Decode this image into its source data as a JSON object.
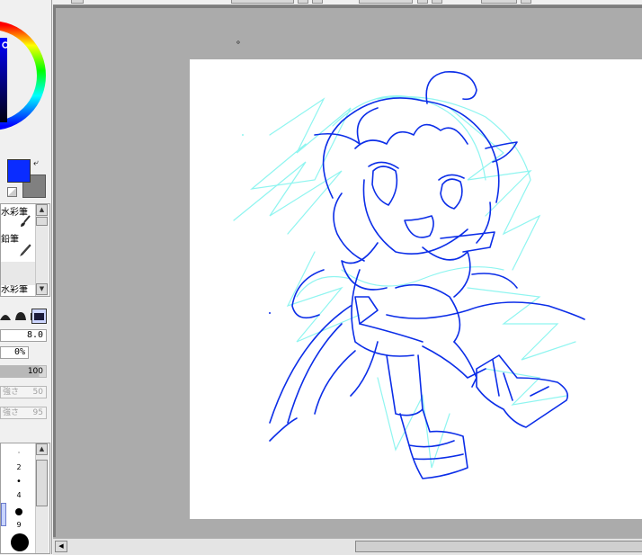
{
  "app": {
    "colors": {
      "foreground": "#0a2cff",
      "background": "#808080",
      "stroke_blue": "#0c2ee8",
      "stroke_cyan": "#8ff5f0"
    }
  },
  "tools": {
    "items": [
      {
        "label": "水彩筆",
        "icon": "paint-brush-icon"
      },
      {
        "label": "鉛筆",
        "icon": "pencil-icon"
      },
      {
        "label": "",
        "icon": ""
      },
      {
        "label": "水彩筆",
        "icon": ""
      }
    ]
  },
  "brush": {
    "shapes": [
      "round-edge-shape",
      "flat-edge-shape",
      "soft-edge-shape",
      "hard-edge-shape"
    ],
    "size": "8.0",
    "min_size": "0%",
    "density": "100",
    "texture_label": "強さ",
    "texture_value": "50",
    "blending_label": "強さ",
    "blending_value": "95"
  },
  "size_palette": {
    "labels": [
      "2",
      "4",
      "9"
    ]
  },
  "canvas": {
    "note": "。"
  }
}
